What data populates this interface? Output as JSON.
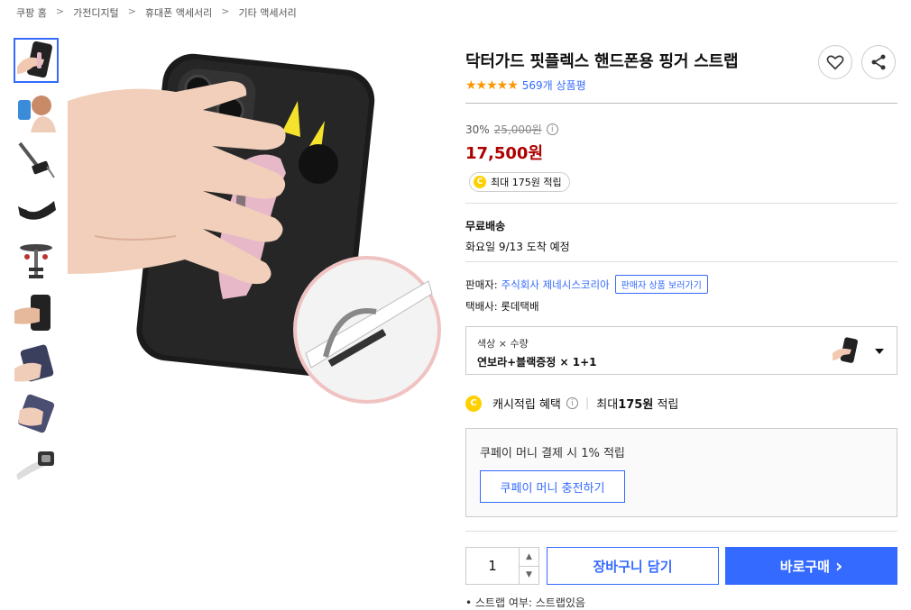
{
  "breadcrumb": [
    "쿠팡 홈",
    "가전디지털",
    "휴대폰 액세서리",
    "기타 액세서리"
  ],
  "breadcrumb_sep": ">",
  "product": {
    "title": "닥터가드 핏플렉스 핸드폰용 핑거 스트랩",
    "rating": 4.5,
    "stars": "★★★★★",
    "review_count": "569개 상품평",
    "discount": "30%",
    "original_price": "25,000원",
    "info_icon": "i",
    "sale_price": "17,500원",
    "cash_pill_coin": "C",
    "cash_pill_text": "최대 175원 적립"
  },
  "shipping": {
    "title": "무료배송",
    "date": "화요일 9/13 도착 예정"
  },
  "seller": {
    "label": "판매자:",
    "name": "주식회사 제네시스코리아",
    "button": "판매자 상품 보러가기",
    "courier": "택배사: 롯데택배"
  },
  "option": {
    "label": "색상 × 수량",
    "value": "연보라+블랙증정 × 1+1"
  },
  "cash_benefit": {
    "coin": "C",
    "label": "캐시적립 혜택",
    "info_icon": "i",
    "bar": "|",
    "text_prefix": "최대 ",
    "amount": "175원",
    "text_suffix": " 적립"
  },
  "coupay": {
    "text": "쿠페이 머니 결제 시 1% 적립",
    "button": "쿠페이 머니 충전하기"
  },
  "purchase": {
    "quantity": "1",
    "qty_up": "▲",
    "qty_down": "▼",
    "cart_label": "장바구니 담기",
    "buy_label": "바로구매",
    "buy_arrow": "›"
  },
  "bottom_note": "• 스트랩 여부: 스트랩있음",
  "icons": {
    "heart": "heart-icon",
    "share": "share-icon"
  },
  "colors": {
    "accent": "#346aff",
    "price": "#ae0000",
    "star": "#ff9600",
    "coin": "#ffd000",
    "strap": "#e6b8c8"
  }
}
